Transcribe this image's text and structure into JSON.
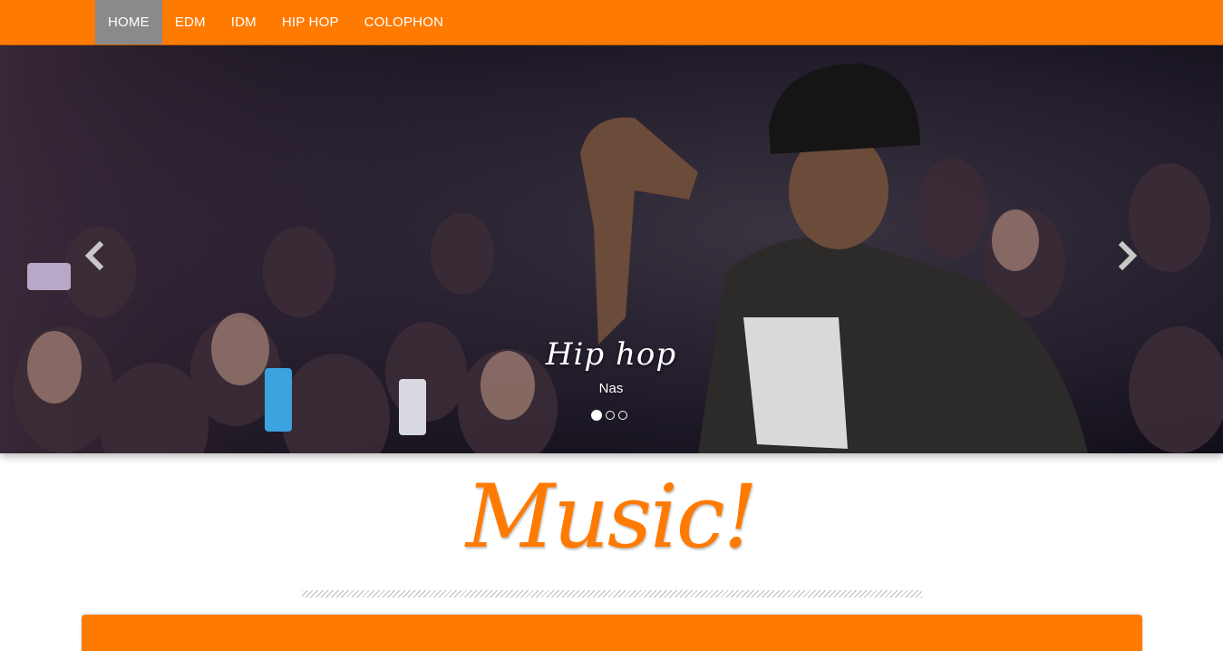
{
  "nav": {
    "items": [
      {
        "label": "HOME",
        "active": true
      },
      {
        "label": "EDM",
        "active": false
      },
      {
        "label": "IDM",
        "active": false
      },
      {
        "label": "HIP HOP",
        "active": false
      },
      {
        "label": "COLOPHON",
        "active": false
      }
    ]
  },
  "carousel": {
    "caption_title": "Hip hop",
    "caption_subtitle": "Nas",
    "slides": 3,
    "active_slide": 1,
    "prev_icon": "chevron-left-icon",
    "next_icon": "chevron-right-icon"
  },
  "main": {
    "title": "Music!"
  },
  "colors": {
    "accent": "#ff7a00",
    "active_nav": "#8a8a8a"
  }
}
